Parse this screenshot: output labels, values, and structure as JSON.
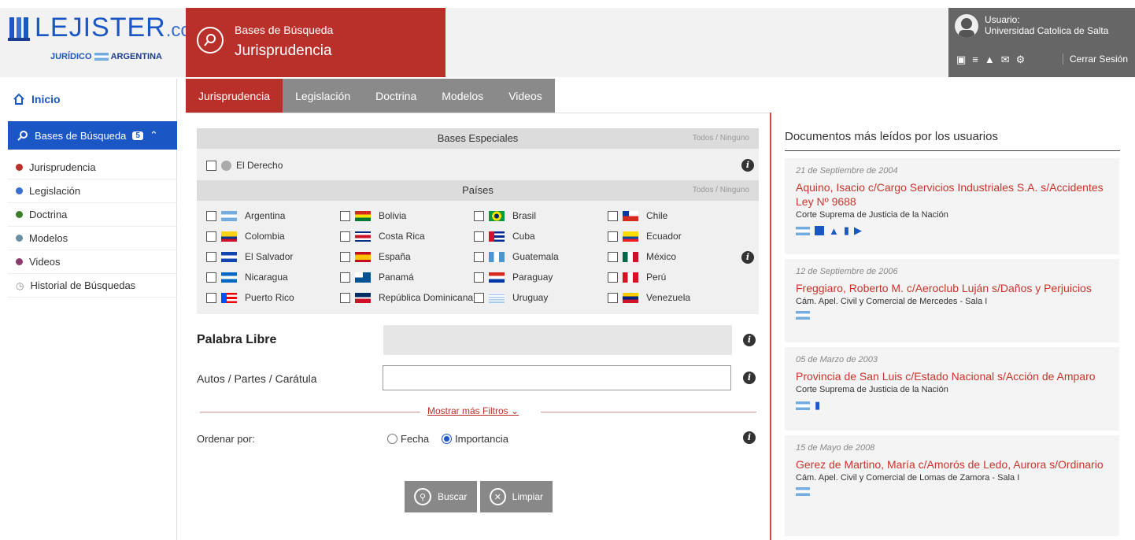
{
  "header": {
    "logo_main": "LEJISTER",
    "logo_dotcom": ".com",
    "logo_jur": "JURÍDICO",
    "logo_country": "ARGENTINA",
    "banner_line1": "Bases de Búsqueda",
    "banner_line2": "Jurisprudencia",
    "user_label": "Usuario:",
    "user_name": "Universidad Catolica de Salta",
    "logout": "Cerrar Sesión"
  },
  "sidebar": {
    "home": "Inicio",
    "bases_label": "Bases de Búsqueda",
    "bases_count": "5",
    "items": [
      {
        "label": "Jurisprudencia",
        "color": "#b9302a"
      },
      {
        "label": "Legislación",
        "color": "#3a6fd1"
      },
      {
        "label": "Doctrina",
        "color": "#3a7d2a"
      },
      {
        "label": "Modelos",
        "color": "#6b8fa3"
      },
      {
        "label": "Videos",
        "color": "#8a3a6e"
      },
      {
        "label": "Historial de Búsquedas",
        "color": ""
      }
    ]
  },
  "tabs": [
    "Jurisprudencia",
    "Legislación",
    "Doctrina",
    "Modelos",
    "Videos"
  ],
  "panel": {
    "especiales_title": "Bases Especiales",
    "todos_ninguno": "Todos / Ninguno",
    "el_derecho": "El Derecho",
    "paises_title": "Países",
    "countries": [
      "Argentina",
      "Bolivia",
      "Brasil",
      "Chile",
      "Colombia",
      "Costa Rica",
      "Cuba",
      "Ecuador",
      "El Salvador",
      "España",
      "Guatemala",
      "México",
      "Nicaragua",
      "Panamá",
      "Paraguay",
      "Perú",
      "Puerto Rico",
      "República Dominicana",
      "Uruguay",
      "Venezuela"
    ]
  },
  "form": {
    "palabra_libre": "Palabra Libre",
    "autos_partes": "Autos / Partes / Carátula",
    "mostrar_filtros": "Mostrar más Filtros",
    "ordenar_por": "Ordenar por:",
    "fecha": "Fecha",
    "importancia": "Importancia",
    "buscar": "Buscar",
    "limpiar": "Limpiar"
  },
  "right": {
    "title": "Documentos más leídos por los usuarios",
    "docs": [
      {
        "date": "21 de Septiembre de 2004",
        "title": "Aquino, Isacio c/Cargo Servicios Industriales S.A. s/Accidentes Ley Nº 9688",
        "court": "Corte Suprema de Justicia de la Nación"
      },
      {
        "date": "12 de Septiembre de 2006",
        "title": "Freggiaro, Roberto M. c/Aeroclub Luján s/Daños y Perjuicios",
        "court": "Cám. Apel. Civil y Comercial de Mercedes - Sala I"
      },
      {
        "date": "05 de Marzo de 2003",
        "title": "Provincia de San Luis c/Estado Nacional s/Acción de Amparo",
        "court": "Corte Suprema de Justicia de la Nación"
      },
      {
        "date": "15 de Mayo de 2008",
        "title": "Gerez de Martino, María c/Amorós de Ledo, Aurora s/Ordinario",
        "court": "Cám. Apel. Civil y Comercial de Lomas de Zamora - Sala I"
      }
    ]
  }
}
